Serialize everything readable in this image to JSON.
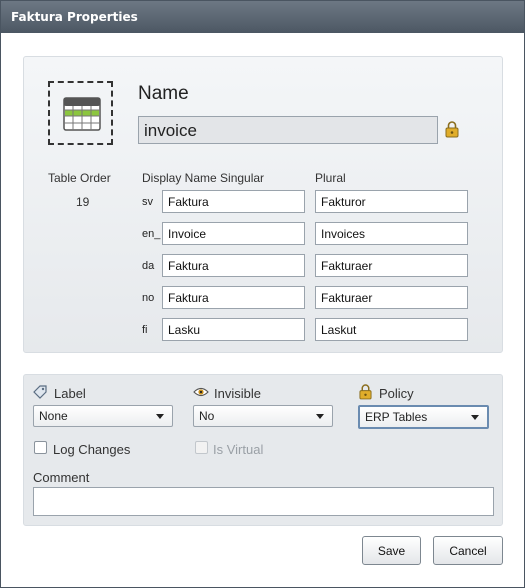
{
  "window": {
    "title": "Faktura Properties"
  },
  "header": {
    "name_label": "Name",
    "name_value": "invoice",
    "table_order_label": "Table Order",
    "table_order_value": "19",
    "display_singular_label": "Display Name Singular",
    "plural_label": "Plural"
  },
  "translations": [
    {
      "lang": "sv",
      "singular": "Faktura",
      "plural": "Fakturor"
    },
    {
      "lang": "en_",
      "singular": "Invoice",
      "plural": "Invoices"
    },
    {
      "lang": "da",
      "singular": "Faktura",
      "plural": "Fakturaer"
    },
    {
      "lang": "no",
      "singular": "Faktura",
      "plural": "Fakturaer"
    },
    {
      "lang": "fi",
      "singular": "Lasku",
      "plural": "Laskut"
    }
  ],
  "options": {
    "label": {
      "caption": "Label",
      "value": "None",
      "icon": "tag-icon"
    },
    "invisible": {
      "caption": "Invisible",
      "value": "No",
      "icon": "eye-icon"
    },
    "policy": {
      "caption": "Policy",
      "value": "ERP Tables",
      "icon": "lock-icon"
    },
    "log_changes": {
      "caption": "Log Changes",
      "checked": false
    },
    "is_virtual": {
      "caption": "Is Virtual",
      "checked": false,
      "disabled": true
    },
    "comment": {
      "caption": "Comment",
      "value": ""
    }
  },
  "buttons": {
    "save": "Save",
    "cancel": "Cancel"
  },
  "colors": {
    "titlebar": "#56616d",
    "accent_green": "#8cc63f",
    "lock": "#d9a520"
  }
}
